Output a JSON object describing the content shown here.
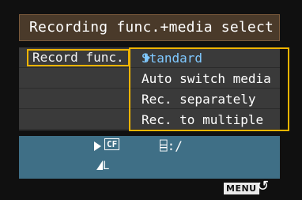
{
  "header": {
    "title": "Recording func.+media select"
  },
  "setting": {
    "label": "Record func.",
    "options": [
      {
        "label": "Standard",
        "selected": true
      },
      {
        "label": "Auto switch media",
        "selected": false
      },
      {
        "label": "Rec. separately",
        "selected": false
      },
      {
        "label": "Rec. to multiple",
        "selected": false
      }
    ]
  },
  "status": {
    "playback_media": "CF",
    "folder": "⌸:/",
    "quality": "L"
  },
  "footer": {
    "menu_label": "MENU",
    "back_icon": "↺"
  },
  "colors": {
    "highlight_border": "#f0b400",
    "selected_text": "#7fc8ff",
    "status_panel": "#3f6f86",
    "title_bar": "#4a3a2a"
  }
}
